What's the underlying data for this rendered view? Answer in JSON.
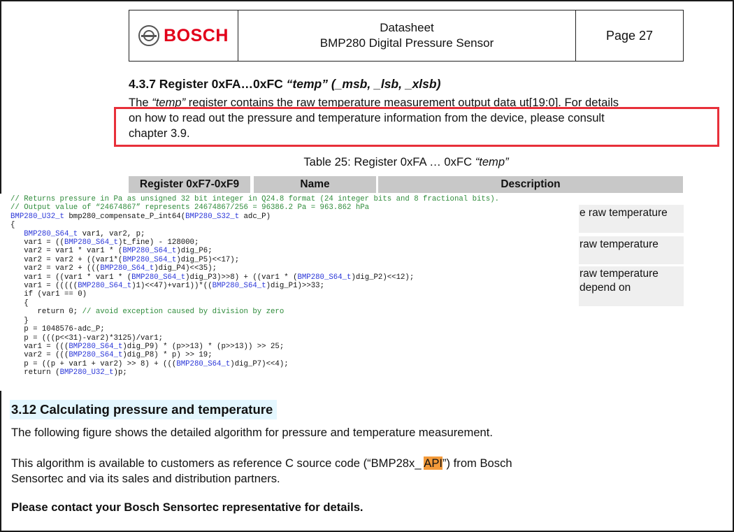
{
  "header": {
    "brand": "BOSCH",
    "doc_type": "Datasheet",
    "product": "BMP280 Digital Pressure Sensor",
    "page": "Page 27"
  },
  "section_437": {
    "title_prefix": "4.3.7 Register 0xFA…0xFC ",
    "title_italic": "“temp”",
    "title_suffix": " (_msb, _lsb, _xlsb)",
    "para_prefix": "The ",
    "para_italic": "“temp”",
    "para_line1_rest": " register contains the raw temperature measurement output data ut[19:0]. For details",
    "para_line2": "on how to read out the pressure and temperature information from the device, please consult",
    "para_line3": "chapter 3.9."
  },
  "table": {
    "caption_prefix": "Table 25: Register 0xFA … 0xFC ",
    "caption_italic": "“temp”",
    "headers": [
      "Register 0xF7-0xF9",
      "Name",
      "Description"
    ],
    "rows": [
      "e raw temperature",
      "raw temperature",
      "raw temperature",
      "depend on"
    ]
  },
  "code": {
    "comment1": "// Returns pressure in Pa as unsigned 32 bit integer in Q24.8 format (24 integer bits and 8 fractional bits).",
    "comment2": "// Output value of “24674867” represents 24674867/256 = 96386.2 Pa = 963.862 hPa",
    "types": {
      "u32": "BMP280_U32_t",
      "s32": "BMP280_S32_t",
      "s64": "BMP280_S64_t"
    },
    "func_name": " bmp280_compensate_P_int64(",
    "func_arg": " adc_P)",
    "open_brace": "{",
    "decl": " var1, var2, p;",
    "comment_div": "// avoid exception caused by division by zero"
  },
  "section_312": {
    "title": "3.12 Calculating pressure and temperature",
    "para1": "The following figure shows the detailed algorithm for pressure and temperature measurement.",
    "para2_prefix": "This algorithm is available to customers as reference C source code (“BMP28x_ ",
    "para2_highlight": "API",
    "para2_suffix": "”) from Bosch",
    "para2_line2": "Sensortec and via its sales and distribution partners.",
    "para3": "Please contact your Bosch Sensortec representative for details."
  },
  "colors": {
    "brand_red": "#e2001a",
    "annotation_box": "#e8303a",
    "code_comment": "#2e8b3a",
    "code_type": "#2a36d8",
    "api_highlight": "#f39a3a",
    "section_highlight": "#e4f7ff"
  }
}
